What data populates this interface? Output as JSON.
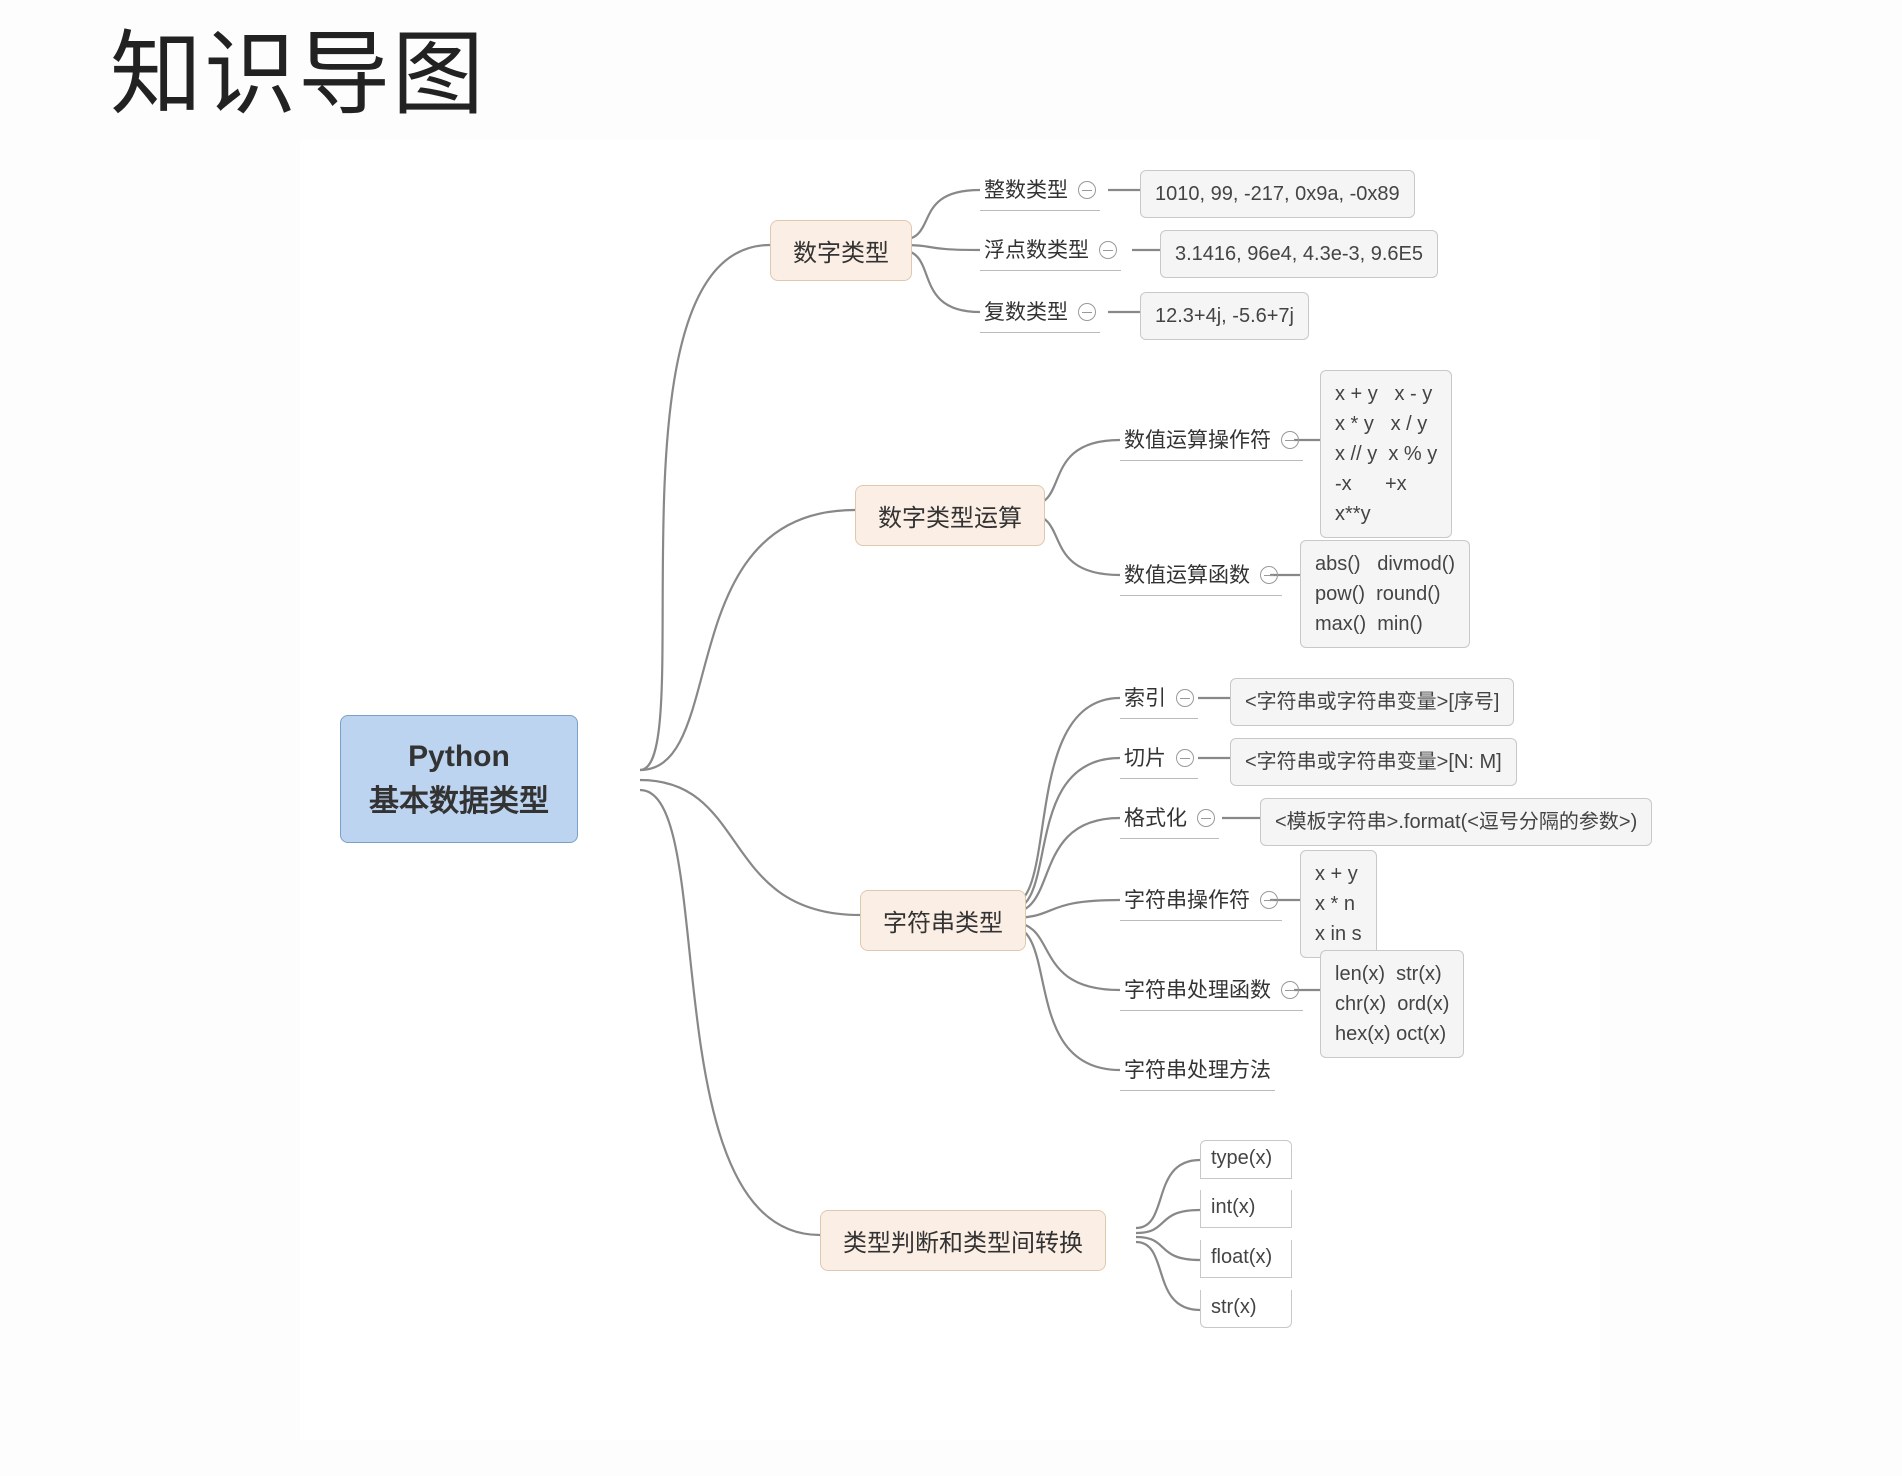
{
  "title": "知识导图",
  "root": {
    "line1": "Python",
    "line2": "基本数据类型"
  },
  "branches": {
    "num": {
      "label": "数字类型",
      "children": {
        "int": {
          "label": "整数类型",
          "example": "1010, 99, -217, 0x9a, -0x89"
        },
        "float": {
          "label": "浮点数类型",
          "example": "3.1416, 96e4, 4.3e-3, 9.6E5"
        },
        "complex": {
          "label": "复数类型",
          "example": "12.3+4j, -5.6+7j"
        }
      }
    },
    "numop": {
      "label": "数字类型运算",
      "children": {
        "ops": {
          "label": "数值运算操作符",
          "example": "x + y   x - y\nx * y   x / y\nx // y  x % y\n-x      +x\nx**y"
        },
        "fns": {
          "label": "数值运算函数",
          "example": "abs()   divmod()\npow()  round()\nmax()  min()"
        }
      }
    },
    "str": {
      "label": "字符串类型",
      "children": {
        "index": {
          "label": "索引",
          "example": "<字符串或字符串变量>[序号]"
        },
        "slice": {
          "label": "切片",
          "example": "<字符串或字符串变量>[N: M]"
        },
        "format": {
          "label": "格式化",
          "example": "<模板字符串>.format(<逗号分隔的参数>)"
        },
        "ops": {
          "label": "字符串操作符",
          "example": "x + y\nx * n\nx in s"
        },
        "fns": {
          "label": "字符串处理函数",
          "example": "len(x)  str(x)\nchr(x)  ord(x)\nhex(x) oct(x)"
        },
        "methods": {
          "label": "字符串处理方法"
        }
      }
    },
    "conv": {
      "label": "类型判断和类型间转换",
      "children": {
        "a": "type(x)",
        "b": "int(x)",
        "c": "float(x)",
        "d": "str(x)"
      }
    }
  }
}
